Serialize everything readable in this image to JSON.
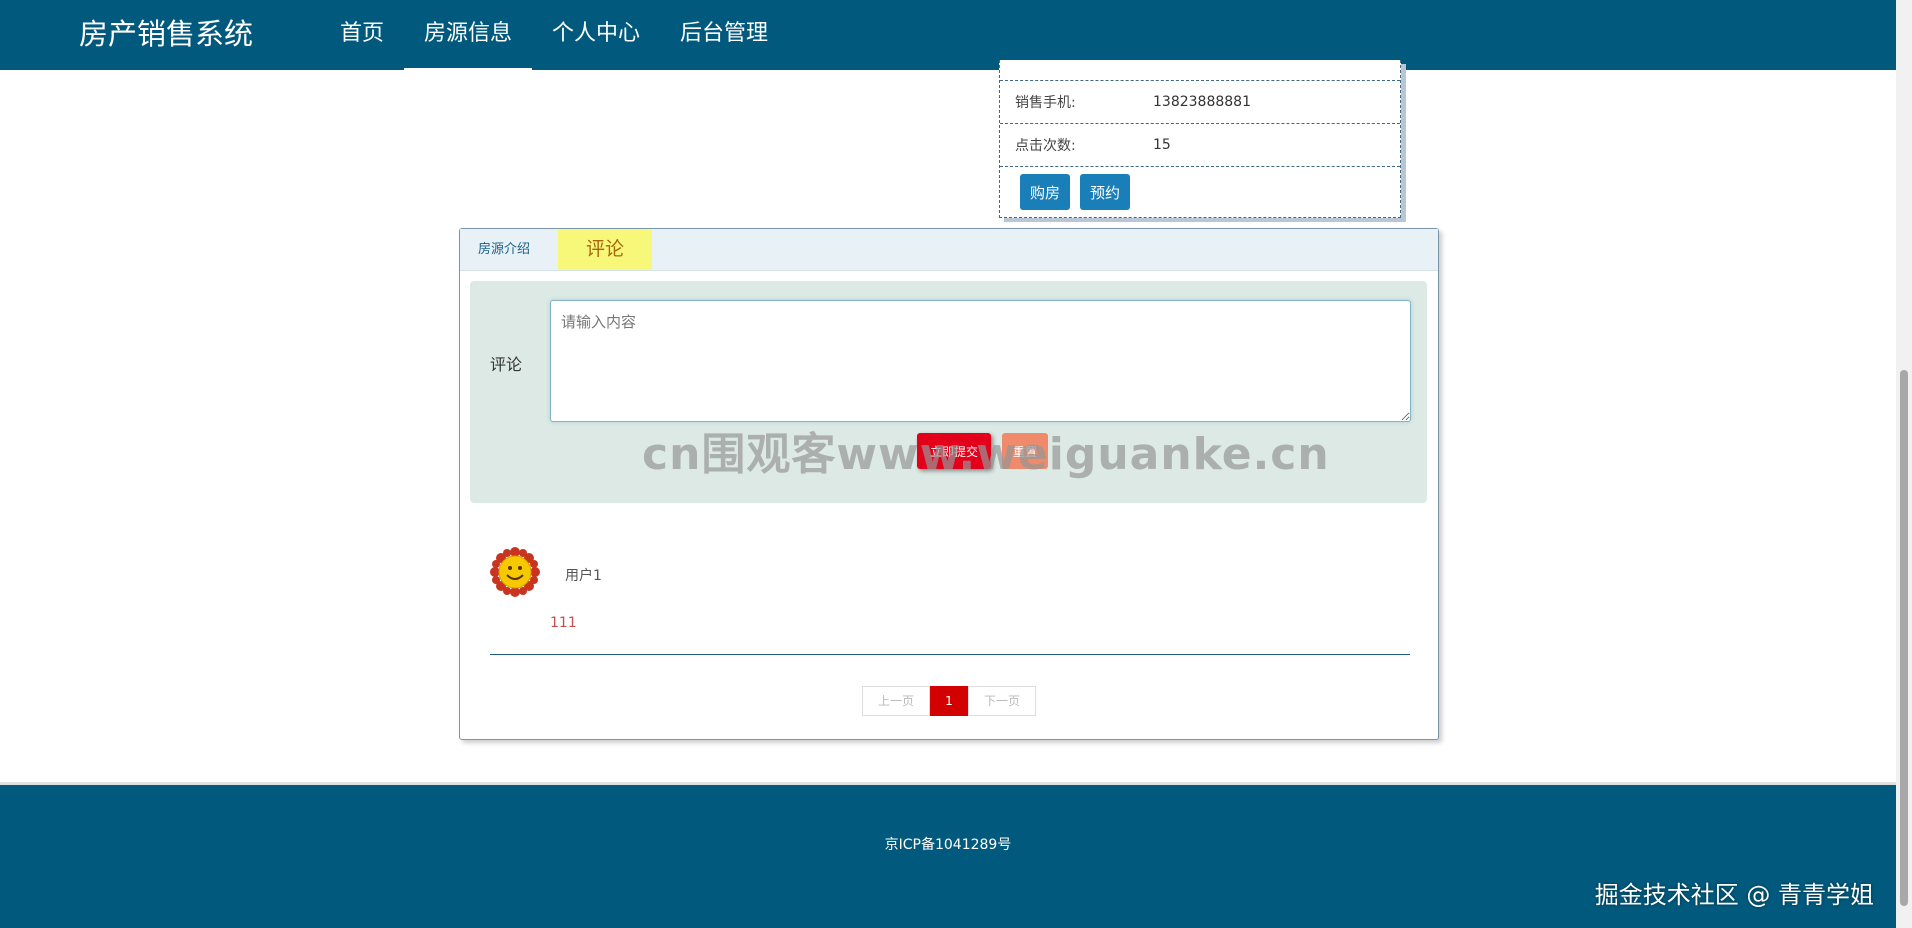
{
  "app": {
    "title": "房产销售系统"
  },
  "nav": {
    "items": [
      {
        "label": "首页"
      },
      {
        "label": "房源信息"
      },
      {
        "label": "个人中心"
      },
      {
        "label": "后台管理"
      }
    ],
    "active": "房源信息"
  },
  "house_info": {
    "rows": [
      {
        "label": "销售手机:",
        "value": "13823888881"
      },
      {
        "label": "点击次数:",
        "value": "15"
      }
    ],
    "buy_label": "购房",
    "reserve_label": "预约"
  },
  "tabs": {
    "intro_label": "房源介绍",
    "comment_label": "评论"
  },
  "comment_form": {
    "label": "评论",
    "placeholder": "请输入内容",
    "submit_label": "立即提交",
    "reset_label": "重置",
    "watermark": "cn围观客www.weiguanke.cn"
  },
  "comments": [
    {
      "user": "用户1",
      "content": "111"
    }
  ],
  "pagination": {
    "prev_label": "上一页",
    "current": "1",
    "next_label": "下一页"
  },
  "footer": {
    "icp": "京ICP备1041289号",
    "credit": "掘金技术社区 @ 青青学姐"
  },
  "colors": {
    "nav_bg": "#015a7d",
    "active_tab_bg": "#f7f87a",
    "submit_bg": "#e3001b",
    "reset_bg": "#ef8b6b",
    "page_current": "#d30000"
  }
}
